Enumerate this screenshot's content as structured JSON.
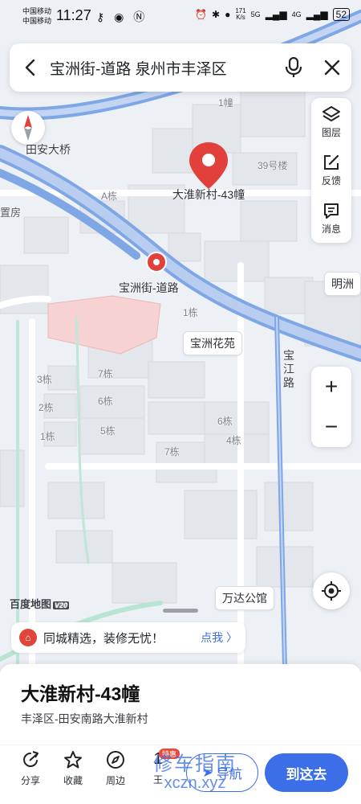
{
  "status_bar": {
    "carrier_1": "中国移动",
    "carrier_2": "中国移动",
    "time": "11:27",
    "net_speed_value": "171",
    "net_speed_unit": "K/s",
    "signal_1": "5G",
    "signal_2": "4G",
    "battery": "52"
  },
  "search": {
    "query": "宝洲街-道路 泉州市丰泽区"
  },
  "map": {
    "labels": {
      "bridge": "田安大桥",
      "building_1": "1幢",
      "building_39": "39号楼",
      "building_a": "A栋",
      "estate_left": "置房",
      "building_1_dong": "1栋",
      "mingzhou": "明洲",
      "road_baojiang": "宝江路",
      "b3": "3栋",
      "b7a": "7栋",
      "b6a": "6栋",
      "b2": "2栋",
      "b5": "5栋",
      "b1": "1栋",
      "b6b": "6栋",
      "b4": "4栋",
      "b7b": "7栋"
    },
    "pin_main_title": "大淮新村-43幢",
    "pin_road_title": "宝洲街-道路",
    "chip_huayuan": "宝洲花苑",
    "chip_wanda": "万达公馆",
    "logo": "百度地图",
    "logo_version": "V20"
  },
  "tools": {
    "layers": "图层",
    "feedback": "反馈",
    "messages": "消息"
  },
  "zoom": {
    "in": "+",
    "out": "−"
  },
  "promo": {
    "text": "同城精选，装修无忧！",
    "cta": "点我 〉"
  },
  "place": {
    "title": "大淮新村-43幢",
    "address": "丰泽区-田安南路大淮新村"
  },
  "actions": {
    "share": "分享",
    "favorite": "收藏",
    "nearby": "周边",
    "tag_badge": "特惠",
    "tag_partial": "1",
    "tag_label_partial": "王",
    "navigate": "导航",
    "go": "到这去"
  },
  "watermark": {
    "line1": "修车指南",
    "line2": "xczn.xyz"
  },
  "colors": {
    "accent": "#3c6ee8",
    "pin": "#e2413b",
    "road_blue": "#7fa7e6"
  }
}
